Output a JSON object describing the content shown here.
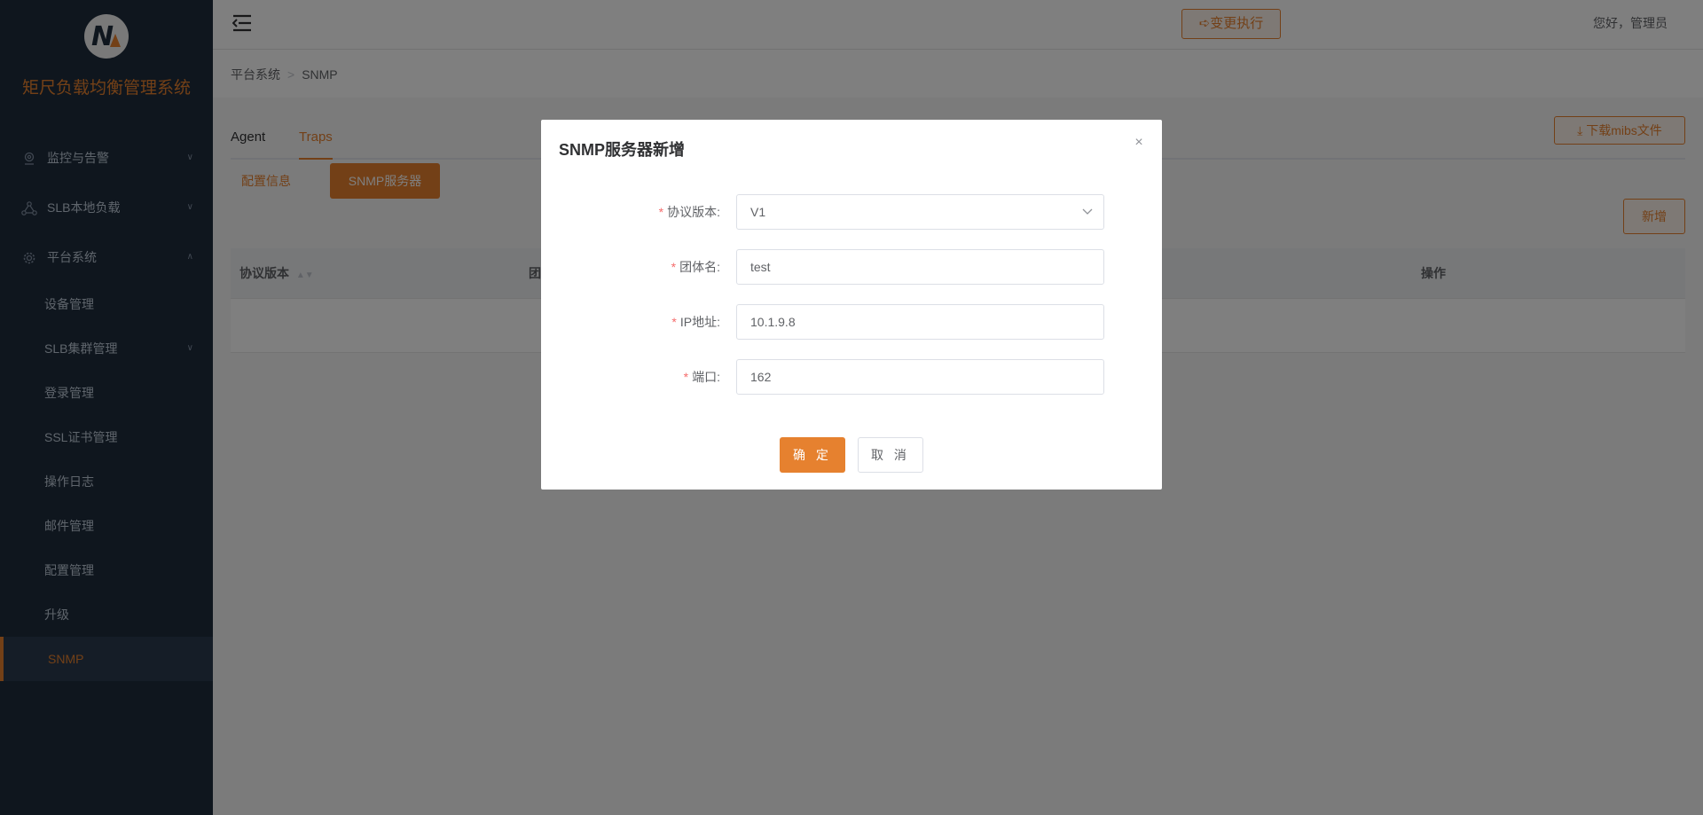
{
  "app": {
    "title": "矩尺负载均衡管理系统",
    "logo_letter": "N"
  },
  "sidebar": {
    "items": [
      {
        "label": "监控与告警",
        "icon": "location-icon",
        "chevron": "∨"
      },
      {
        "label": "SLB本地负载",
        "icon": "network-icon",
        "chevron": "∨"
      },
      {
        "label": "平台系统",
        "icon": "gear-icon",
        "chevron": "∧"
      }
    ],
    "sub_items": [
      {
        "label": "设备管理"
      },
      {
        "label": "SLB集群管理",
        "chevron": "∨"
      },
      {
        "label": "登录管理"
      },
      {
        "label": "SSL证书管理"
      },
      {
        "label": "操作日志"
      },
      {
        "label": "邮件管理"
      },
      {
        "label": "配置管理"
      },
      {
        "label": "升级"
      },
      {
        "label": "SNMP",
        "active": true
      }
    ]
  },
  "header": {
    "change_exec_label": "变更执行",
    "greeting": "您好，管理员"
  },
  "breadcrumb": {
    "items": [
      "平台系统",
      "SNMP"
    ],
    "separator": ">"
  },
  "main": {
    "tabs": [
      {
        "label": "Agent"
      },
      {
        "label": "Traps",
        "active": true
      }
    ],
    "download_label": "下载mibs文件",
    "subtabs": [
      {
        "label": "配置信息"
      },
      {
        "label": "SNMP服务器",
        "active": true
      }
    ],
    "add_label": "新增",
    "table_columns": [
      "协议版本",
      "团",
      "操作"
    ]
  },
  "modal": {
    "title": "SNMP服务器新增",
    "close_glyph": "×",
    "fields": [
      {
        "label": "协议版本:",
        "value": "V1",
        "type": "select"
      },
      {
        "label": "团体名:",
        "value": "test",
        "type": "text"
      },
      {
        "label": "IP地址:",
        "value": "10.1.9.8",
        "type": "text"
      },
      {
        "label": "端口:",
        "value": "162",
        "type": "text"
      }
    ],
    "required_mark": "*",
    "ok_label": "确 定",
    "cancel_label": "取 消"
  },
  "colors": {
    "accent": "#e6812f",
    "sidebar_bg": "#1f2d3d",
    "required": "#f56c6c"
  }
}
